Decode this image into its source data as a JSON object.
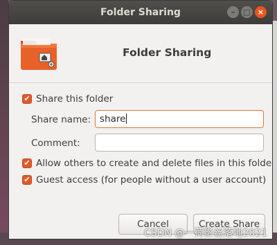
{
  "window": {
    "title": "Folder Sharing",
    "wm_minimize": "–",
    "wm_maximize": "□",
    "wm_close": "×"
  },
  "dialog": {
    "heading": "Folder Sharing",
    "folder_icon": "folder-share-icon"
  },
  "options": {
    "share_this_folder": {
      "label": "Share this folder",
      "checked": true
    },
    "share_name_label": "Share name:",
    "share_name_value": "share",
    "comment_label": "Comment:",
    "comment_value": "",
    "allow_others": {
      "label": "Allow others to create and delete files in this folder",
      "checked": true
    },
    "guest_access": {
      "label": "Guest access (for people without a user account)",
      "checked": true
    }
  },
  "buttons": {
    "cancel": "Cancel",
    "create_share": "Create Share"
  },
  "watermark": "CSDN @一荷影丝落地2021",
  "colors": {
    "accent": "#e15a2a",
    "titlebar": "#3d3c38",
    "dialog_bg": "#f2f1f0"
  }
}
